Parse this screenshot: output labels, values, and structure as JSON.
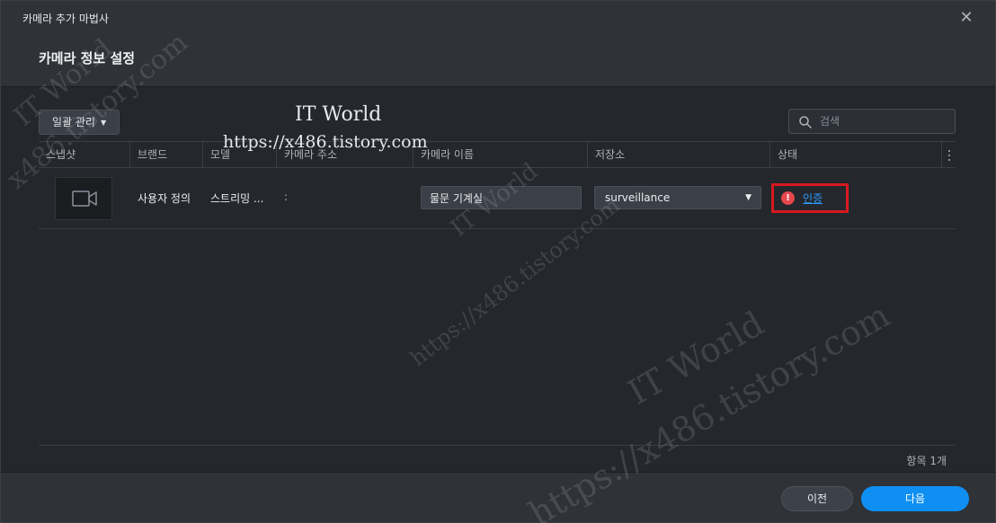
{
  "window": {
    "title": "카메라 추가 마법사",
    "close_icon": "close-icon"
  },
  "step": {
    "title": "카메라 정보 설정"
  },
  "toolbar": {
    "bulk_label": "일괄 관리",
    "search_placeholder": "검색"
  },
  "table": {
    "columns": [
      "스냅샷",
      "브랜드",
      "모델",
      "카메라 주소",
      "카메라 이름",
      "저장소",
      "상태"
    ],
    "rows": [
      {
        "snapshot_icon": "video-camera-icon",
        "brand": "사용자 정의",
        "model": "스트리밍 ...",
        "address": ":",
        "name": "물문 기계실",
        "storage": "surveillance",
        "status_icon": "error-icon",
        "status_link": "인증"
      }
    ]
  },
  "footer": {
    "count": "항목 1개"
  },
  "actions": {
    "prev_label": "이전",
    "next_label": "다음"
  },
  "watermarks": {
    "brand": "IT World",
    "url": "https://x486.tistory.com",
    "side_brand": "IT World",
    "side_url": "x486.tistory.com"
  },
  "colors": {
    "accent": "#0f8ff2",
    "error": "#e5484d",
    "highlight_border": "#d71920",
    "link": "#2f9bff"
  }
}
